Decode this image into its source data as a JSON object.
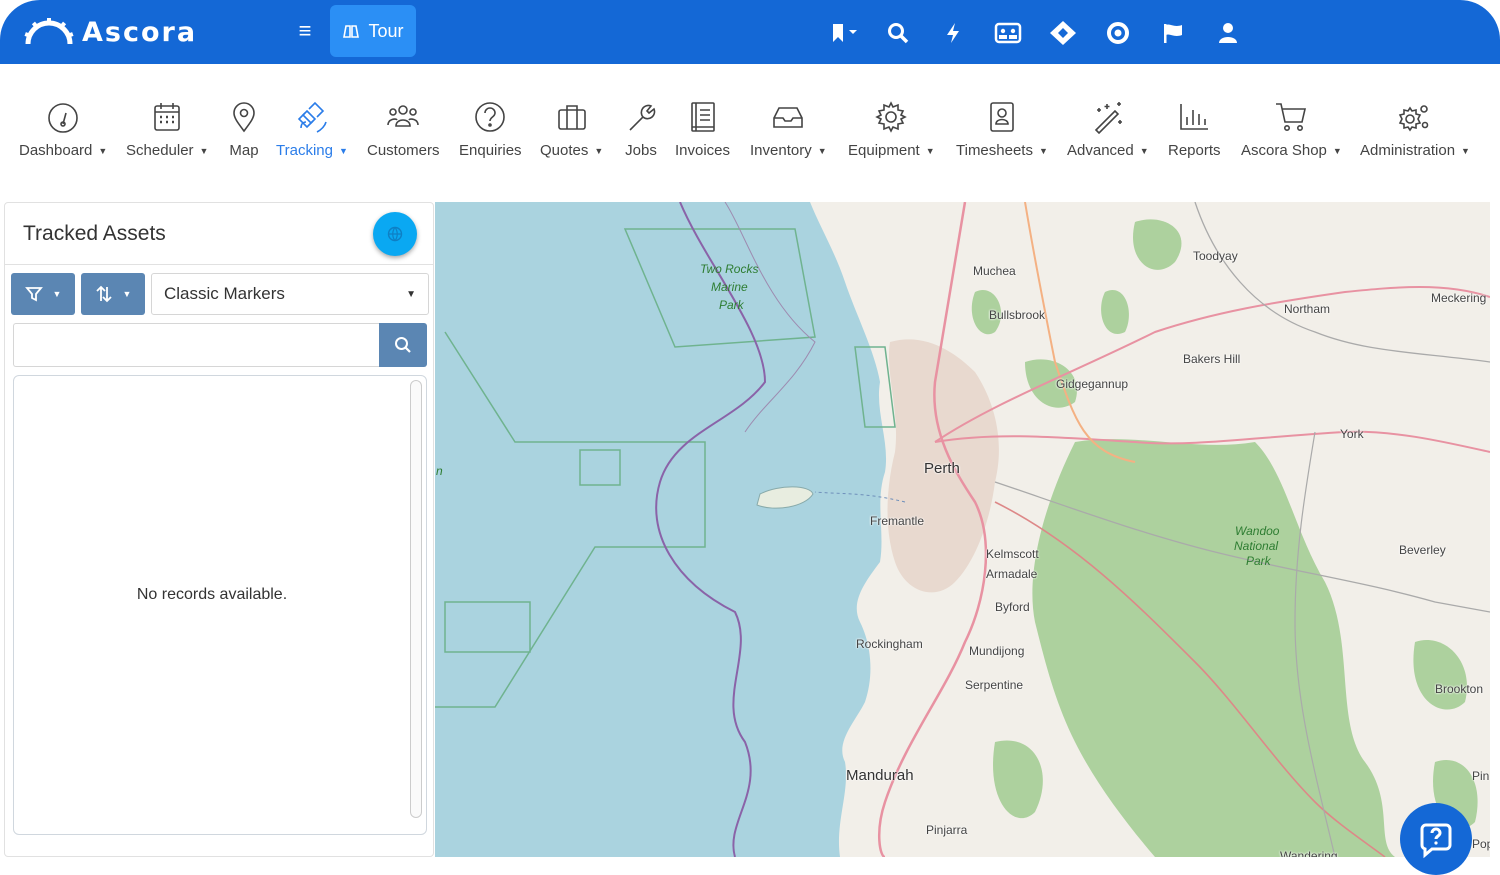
{
  "brand": {
    "name": "Ascora"
  },
  "topbar": {
    "tour_label": "Tour",
    "icons": [
      "bookmark-icon",
      "search-icon",
      "lightning-icon",
      "team-icon",
      "ticket-icon",
      "support-icon",
      "flag-icon",
      "user-icon"
    ]
  },
  "nav": {
    "items": [
      {
        "label": "Dashboard",
        "dropdown": true
      },
      {
        "label": "Scheduler",
        "dropdown": true
      },
      {
        "label": "Map",
        "dropdown": false
      },
      {
        "label": "Tracking",
        "dropdown": true,
        "active": true
      },
      {
        "label": "Customers",
        "dropdown": false
      },
      {
        "label": "Enquiries",
        "dropdown": false
      },
      {
        "label": "Quotes",
        "dropdown": true
      },
      {
        "label": "Jobs",
        "dropdown": false
      },
      {
        "label": "Invoices",
        "dropdown": false
      },
      {
        "label": "Inventory",
        "dropdown": true
      },
      {
        "label": "Equipment",
        "dropdown": true
      },
      {
        "label": "Timesheets",
        "dropdown": true
      },
      {
        "label": "Advanced",
        "dropdown": true
      },
      {
        "label": "Reports",
        "dropdown": false
      },
      {
        "label": "Ascora Shop",
        "dropdown": true
      },
      {
        "label": "Administration",
        "dropdown": true
      }
    ]
  },
  "panel": {
    "title": "Tracked Assets",
    "marker_select": "Classic Markers",
    "search_value": "",
    "empty_message": "No records available."
  },
  "map": {
    "places": [
      "Two Rocks",
      "Marine",
      "Park",
      "Muchea",
      "Toodyay",
      "Bullsbrook",
      "Meckering",
      "Northam",
      "Bakers Hill",
      "Gidgegannup",
      "York",
      "Perth",
      "Fremantle",
      "Kelmscott",
      "Armadale",
      "Wandoo",
      "National",
      "Park",
      "Beverley",
      "Byford",
      "Rockingham",
      "Mundijong",
      "Serpentine",
      "Brookton",
      "Mandurah",
      "Pinjarra",
      "Pin",
      "Wandering",
      "Pop",
      "n"
    ]
  },
  "colors": {
    "brand_blue": "#1468d6",
    "accent": "#2b7de9",
    "tool_btn": "#5b86b3",
    "globe": "#0aa8f2",
    "sea": "#aad3df",
    "land": "#f2efe9",
    "forest": "#add19e"
  }
}
